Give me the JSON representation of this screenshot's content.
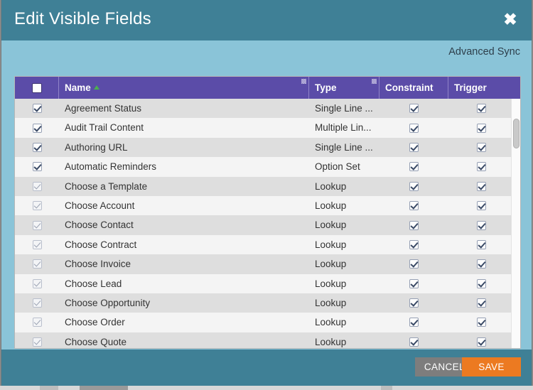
{
  "dialog": {
    "title": "Edit Visible Fields",
    "close_label": "✖",
    "advanced_sync_label": "Advanced Sync"
  },
  "colors": {
    "header_teal": "#3f8096",
    "body_blue": "#8ac4d8",
    "grid_header_purple": "#5b4ca8",
    "save_orange": "#ec7a21",
    "cancel_gray": "#7d7d7d",
    "sort_arrow_green": "#4caf50",
    "row_odd": "#dedede",
    "row_even": "#f4f4f4"
  },
  "grid": {
    "select_all_checked": false,
    "sort_column": "Name",
    "sort_direction": "ascending",
    "columns": [
      {
        "key": "select",
        "label": "",
        "resizable": false
      },
      {
        "key": "name",
        "label": "Name",
        "resizable": true
      },
      {
        "key": "type",
        "label": "Type",
        "resizable": true
      },
      {
        "key": "constraint",
        "label": "Constraint",
        "resizable": false
      },
      {
        "key": "trigger",
        "label": "Trigger",
        "resizable": false
      }
    ],
    "rows": [
      {
        "selected": true,
        "selected_enabled": true,
        "name": "Agreement Status",
        "type": "Single Line ...",
        "constraint": true,
        "trigger": true
      },
      {
        "selected": true,
        "selected_enabled": true,
        "name": "Audit Trail Content",
        "type": "Multiple Lin...",
        "constraint": true,
        "trigger": true
      },
      {
        "selected": true,
        "selected_enabled": true,
        "name": "Authoring URL",
        "type": "Single Line ...",
        "constraint": true,
        "trigger": true
      },
      {
        "selected": true,
        "selected_enabled": true,
        "name": "Automatic Reminders",
        "type": "Option Set",
        "constraint": true,
        "trigger": true
      },
      {
        "selected": true,
        "selected_enabled": false,
        "name": "Choose a Template",
        "type": "Lookup",
        "constraint": true,
        "trigger": true
      },
      {
        "selected": true,
        "selected_enabled": false,
        "name": "Choose Account",
        "type": "Lookup",
        "constraint": true,
        "trigger": true
      },
      {
        "selected": true,
        "selected_enabled": false,
        "name": "Choose Contact",
        "type": "Lookup",
        "constraint": true,
        "trigger": true
      },
      {
        "selected": true,
        "selected_enabled": false,
        "name": "Choose Contract",
        "type": "Lookup",
        "constraint": true,
        "trigger": true
      },
      {
        "selected": true,
        "selected_enabled": false,
        "name": "Choose Invoice",
        "type": "Lookup",
        "constraint": true,
        "trigger": true
      },
      {
        "selected": true,
        "selected_enabled": false,
        "name": "Choose Lead",
        "type": "Lookup",
        "constraint": true,
        "trigger": true
      },
      {
        "selected": true,
        "selected_enabled": false,
        "name": "Choose Opportunity",
        "type": "Lookup",
        "constraint": true,
        "trigger": true
      },
      {
        "selected": true,
        "selected_enabled": false,
        "name": "Choose Order",
        "type": "Lookup",
        "constraint": true,
        "trigger": true
      },
      {
        "selected": true,
        "selected_enabled": false,
        "name": "Choose Quote",
        "type": "Lookup",
        "constraint": true,
        "trigger": true
      }
    ],
    "scrollbar": {
      "visible": true,
      "thumb_position_pct": 8,
      "thumb_size_pct": 12
    }
  },
  "footer": {
    "cancel_label": "CANCEL",
    "save_label": "SAVE"
  }
}
